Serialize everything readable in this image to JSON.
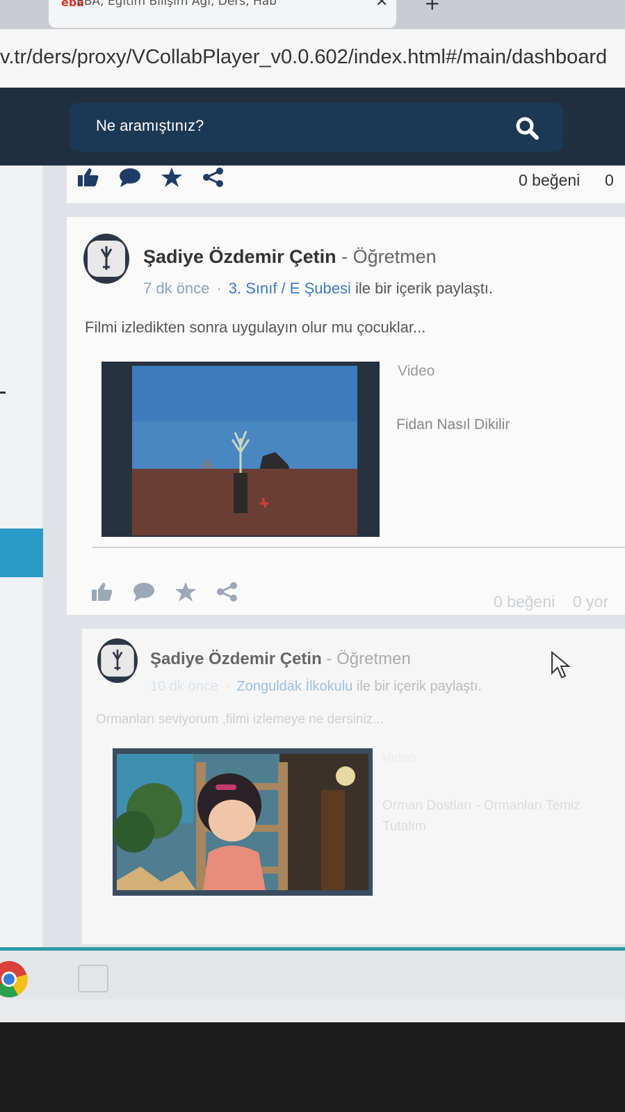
{
  "browser": {
    "tab_title": "EBA, Eğitim Bilişim Ağı, Ders, Hab",
    "url": "v.tr/ders/proxy/VCollabPlayer_v0.0.602/index.html#/main/dashboard"
  },
  "header": {
    "search_placeholder": "Ne aramıştınız?"
  },
  "top_card": {
    "likes": "0 beğeni",
    "extra": "0"
  },
  "posts": [
    {
      "author": "Şadiye Özdemir Çetin",
      "role": "- Öğretmen",
      "time": "7 dk önce",
      "separator": "·",
      "group": "3. Sınıf / E Şubesi",
      "action": "ile bir içerik paylaştı.",
      "text": "Filmi izledikten sonra uygulayın olur mu çocuklar...",
      "media_type": "Video",
      "media_title": "Fidan Nasıl Dikilir",
      "likes": "0 beğeni",
      "extra": "0 yor"
    },
    {
      "author": "Şadiye Özdemir Çetin",
      "role": "- Öğretmen",
      "time": "10 dk önce",
      "separator": "·",
      "group": "Zonguldak İlkokulu",
      "action": "ile bir içerik paylaştı.",
      "text": "Ormanları seviyorum ,filmi izlemeye ne dersiniz...",
      "media_type": "Video",
      "media_title": "Orman Dostları - Ormanları Temiz Tutalım"
    }
  ],
  "colors": {
    "header_bg": "#1f2f40",
    "search_bg": "#1b3854",
    "link": "#3c7ac2",
    "accent": "#2a9ac6"
  }
}
